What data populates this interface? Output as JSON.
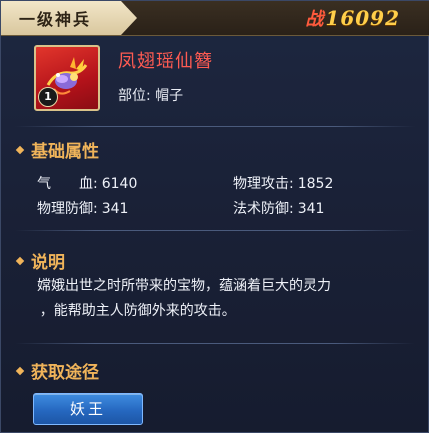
{
  "header": {
    "tier_label": "一级神兵",
    "power_icon": "战",
    "power_value": "16092"
  },
  "item": {
    "name": "凤翅瑶仙簪",
    "badge": "1",
    "slot_label": "部位:",
    "slot_value": "帽子",
    "icon": "phoenix-hairpin-icon"
  },
  "basic_attributes": {
    "title": "基础属性",
    "stats": [
      {
        "label": "气　　血:",
        "value": "6140"
      },
      {
        "label": "物理攻击:",
        "value": "1852"
      },
      {
        "label": "物理防御:",
        "value": "341"
      },
      {
        "label": "法术防御:",
        "value": "341"
      }
    ]
  },
  "description": {
    "title": "说明",
    "lines": [
      "嫦娥出世之时所带来的宝物，蕴涵着巨大的灵力",
      "，能帮助主人防御外来的攻击。"
    ]
  },
  "acquisition": {
    "title": "获取途径",
    "sources": [
      "妖王"
    ]
  },
  "colors": {
    "accent_gold": "#f0b45a",
    "item_name_red": "#ff5b52",
    "power_gold": "#ffcf4a",
    "button_blue": "#2668c0"
  }
}
